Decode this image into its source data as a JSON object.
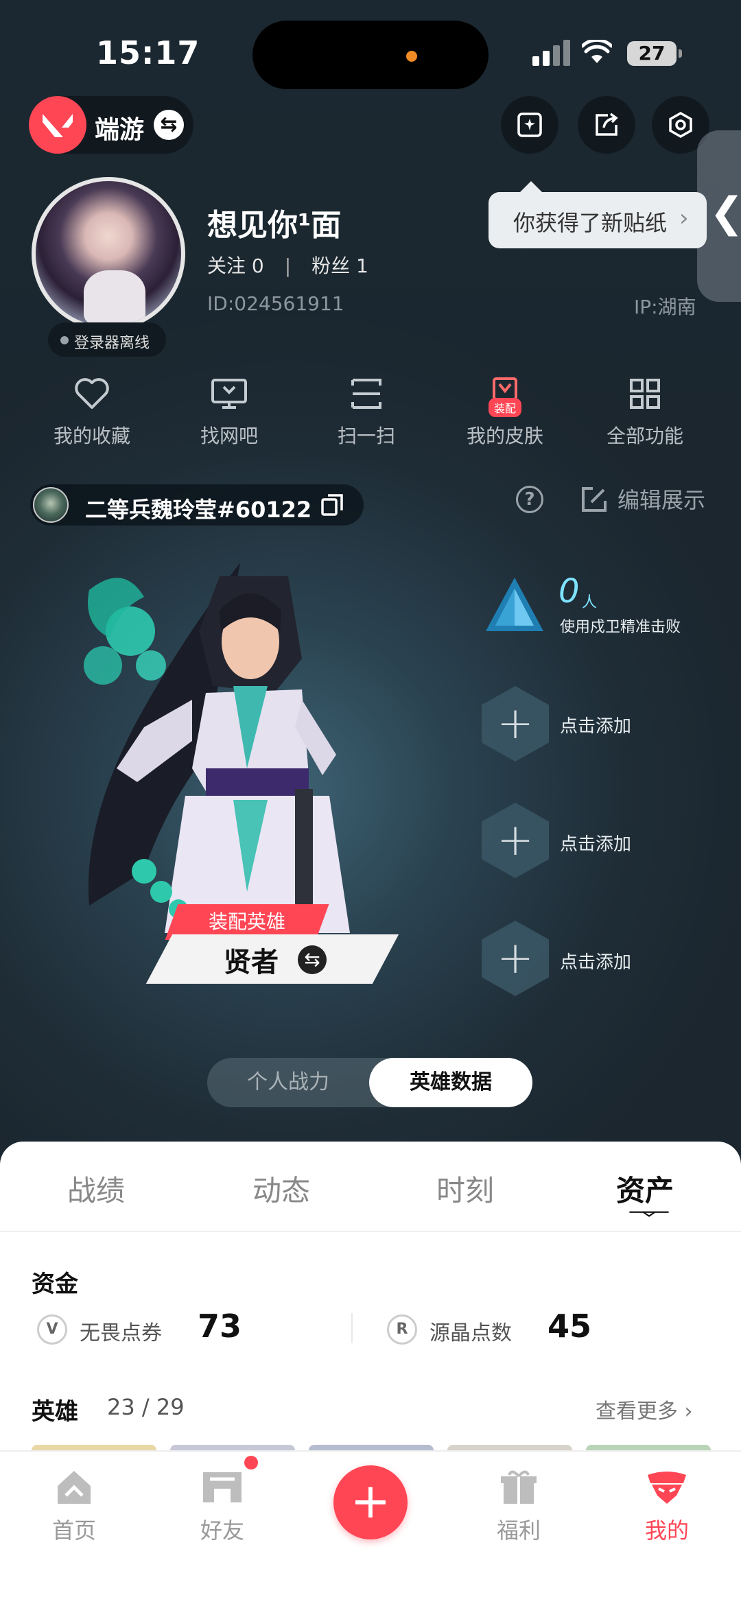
{
  "status_bar": {
    "time": "15:17",
    "battery": "27"
  },
  "header": {
    "app_name": "端游",
    "swap_symbol": "⇆",
    "tooltip": "你获得了新贴纸",
    "side_arrow": "❮"
  },
  "profile": {
    "username": "想见你¹面",
    "follow_label": "关注 0",
    "fans_label": "粉丝 1",
    "separator": "|",
    "id_text": "ID:024561911",
    "ip_text": "IP:湖南",
    "online_status": "登录器离线"
  },
  "quick_actions": [
    {
      "label": "我的收藏",
      "icon": "heart-icon"
    },
    {
      "label": "找网吧",
      "icon": "monitor-icon"
    },
    {
      "label": "扫一扫",
      "icon": "scan-icon"
    },
    {
      "label": "我的皮肤",
      "icon": "skin-icon",
      "badge": "装配"
    },
    {
      "label": "全部功能",
      "icon": "grid-icon"
    }
  ],
  "riot": {
    "id": "二等兵魏玲莹#60122",
    "help_symbol": "?",
    "edit_label": "编辑展示"
  },
  "hero": {
    "tag": "装配英雄",
    "name": "贤者",
    "swap_symbol": "⇆"
  },
  "stats": {
    "count": "0",
    "unit": "人",
    "desc": "使用戍卫精准击败",
    "add_label": "点击添加",
    "plus": "+"
  },
  "segment": {
    "left": "个人战力",
    "right": "英雄数据"
  },
  "tabs": [
    "战绩",
    "动态",
    "时刻",
    "资产"
  ],
  "assets": {
    "funds_title": "资金",
    "vp_icon": "V",
    "vp_label": "无畏点券",
    "vp_value": "73",
    "rp_icon": "R",
    "rp_label": "源晶点数",
    "rp_value": "45",
    "heroes_title": "英雄",
    "heroes_count": "23 / 29",
    "see_more": "查看更多 ›"
  },
  "nav": {
    "home": "首页",
    "friends": "好友",
    "fab": "+",
    "welfare": "福利",
    "mine": "我的"
  },
  "colors": {
    "accent": "#ff4655",
    "dark_bg": "#1d2830",
    "stat_cyan": "#7ee3ff"
  }
}
